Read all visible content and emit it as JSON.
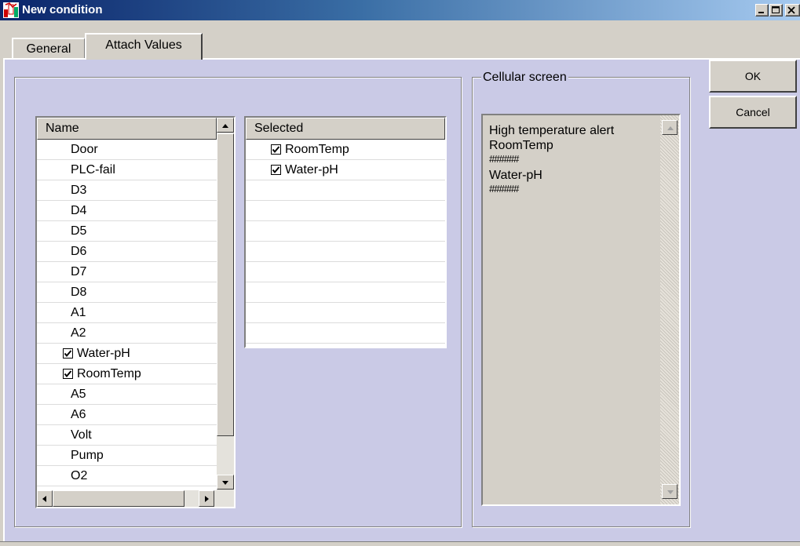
{
  "window": {
    "title": "New condition"
  },
  "tabs": [
    {
      "label": "General"
    },
    {
      "label": "Attach Values"
    }
  ],
  "names_list": {
    "header": "Name",
    "items": [
      {
        "label": "Door",
        "checked": false
      },
      {
        "label": "PLC-fail",
        "checked": false
      },
      {
        "label": "D3",
        "checked": false
      },
      {
        "label": "D4",
        "checked": false
      },
      {
        "label": "D5",
        "checked": false
      },
      {
        "label": "D6",
        "checked": false
      },
      {
        "label": "D7",
        "checked": false
      },
      {
        "label": "D8",
        "checked": false
      },
      {
        "label": "A1",
        "checked": false
      },
      {
        "label": "A2",
        "checked": false
      },
      {
        "label": "Water-pH",
        "checked": true
      },
      {
        "label": "RoomTemp",
        "checked": true
      },
      {
        "label": "A5",
        "checked": false
      },
      {
        "label": "A6",
        "checked": false
      },
      {
        "label": "Volt",
        "checked": false
      },
      {
        "label": "Pump",
        "checked": false
      },
      {
        "label": "O2",
        "checked": false
      }
    ]
  },
  "selected_list": {
    "header": "Selected",
    "items": [
      {
        "label": "RoomTemp",
        "checked": true
      },
      {
        "label": "Water-pH",
        "checked": true
      }
    ]
  },
  "cellular": {
    "title": "Cellular screen",
    "lines": [
      "High temperature alert",
      "RoomTemp",
      "######",
      "Water-pH",
      "######"
    ]
  },
  "buttons": {
    "ok": "OK",
    "cancel": "Cancel"
  }
}
